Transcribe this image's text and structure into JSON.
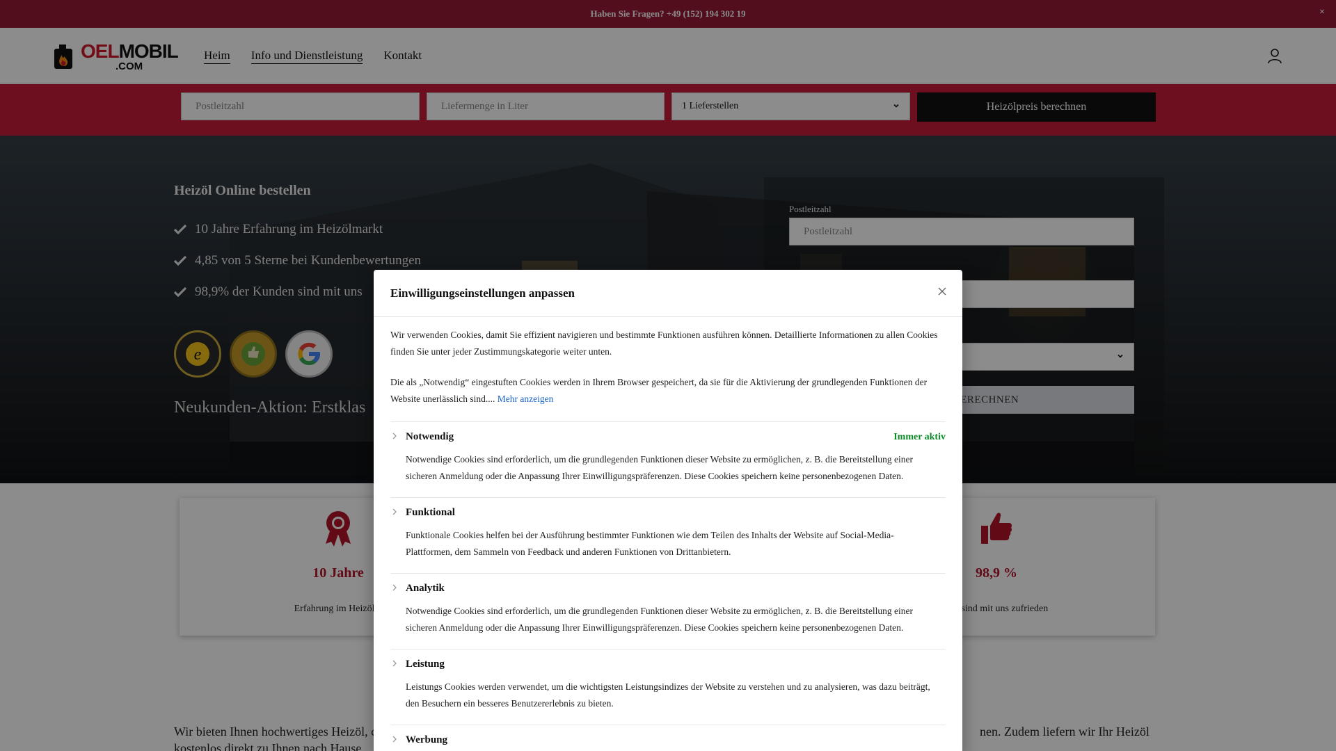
{
  "topbar": {
    "text": "Haben Sie Fragen? +49 (152) 194 302 19",
    "close": "×"
  },
  "logo": {
    "part1": "OEL",
    "part2": "MOBIL",
    "part3": ".COM"
  },
  "nav": {
    "items": [
      "Heim",
      "Info und Dienstleistung",
      "Kontakt"
    ]
  },
  "formbar": {
    "zip_placeholder": "Postleitzahl",
    "amount_placeholder": "Liefermenge in Liter",
    "stations_selected": "1 Lieferstellen",
    "button": "Heizölpreis berechnen"
  },
  "hero": {
    "title": "Heizöl Online bestellen",
    "features": [
      "10 Jahre Erfahrung im Heizölmarkt",
      "4,85 von 5 Sterne bei Kundenbewertungen",
      "98,9% der Kunden sind mit uns"
    ],
    "promo": "Neukunden-Aktion: Erstklas",
    "form": {
      "zip_label": "Postleitzahl",
      "zip_placeholder": "Postleitzahl",
      "button": "BERECHNEN"
    }
  },
  "stats": [
    {
      "value": "10 Jahre",
      "desc": "Erfahrung im Heizölm"
    },
    {
      "value": "98,9 %",
      "desc": "den sind mit uns zufrieden"
    }
  ],
  "bottom_text": {
    "left": "Wir bieten Ihnen hochwertiges Heizöl, c",
    "right": "nen. Zudem liefern wir Ihr Heizöl",
    "line2": "kostenlos direkt zu Ihnen nach Hause"
  },
  "modal": {
    "title": "Einwilligungseinstellungen anpassen",
    "intro": "Wir verwenden Cookies, damit Sie effizient navigieren und bestimmte Funktionen ausführen können. Detaillierte Informationen zu allen Cookies finden Sie unter jeder Zustimmungskategorie weiter unten.",
    "intro2": "Die als „Notwendig“ eingestuften Cookies werden in Ihrem Browser gespeichert, da sie für die Aktivierung der grundlegenden Funktionen der Website unerlässlich sind....",
    "more_link": "Mehr anzeigen",
    "categories": [
      {
        "name": "Notwendig",
        "status": "Immer aktiv",
        "text": "Notwendige Cookies sind erforderlich, um die grundlegenden Funktionen dieser Website zu ermöglichen, z. B. die Bereitstellung einer sicheren Anmeldung oder die Anpassung Ihrer Einwilligungspräferenzen. Diese Cookies speichern keine personenbezogenen Daten."
      },
      {
        "name": "Funktional",
        "text": "Funktionale Cookies helfen bei der Ausführung bestimmter Funktionen wie dem Teilen des Inhalts der Website auf Social-Media-Plattformen, dem Sammeln von Feedback und anderen Funktionen von Drittanbietern."
      },
      {
        "name": "Analytik",
        "text": "Notwendige Cookies sind erforderlich, um die grundlegenden Funktionen dieser Website zu ermöglichen, z. B. die Bereitstellung einer sicheren Anmeldung oder die Anpassung Ihrer Einwilligungspräferenzen. Diese Cookies speichern keine personenbezogenen Daten."
      },
      {
        "name": "Leistung",
        "text": "Leistungs Cookies werden verwendet, um die wichtigsten Leistungsindizes der Website zu verstehen und zu analysieren, was dazu beiträgt, den Besuchern ein besseres Benutzererlebnis zu bieten."
      },
      {
        "name": "Werbung"
      }
    ]
  },
  "colors": {
    "topbar": "#951a33",
    "formbar": "#c81d3a",
    "accent": "#b3142a",
    "active_green": "#0a8a27",
    "link": "#1a63c7"
  },
  "icons": [
    "close-icon",
    "flame-logo-icon",
    "user-icon",
    "chevron-down-icon",
    "checkmark-icon",
    "trusted-shops-badge",
    "ekomi-badge",
    "google-badge",
    "award-ribbon-icon",
    "thumbs-up-icon",
    "chevron-right-icon"
  ]
}
